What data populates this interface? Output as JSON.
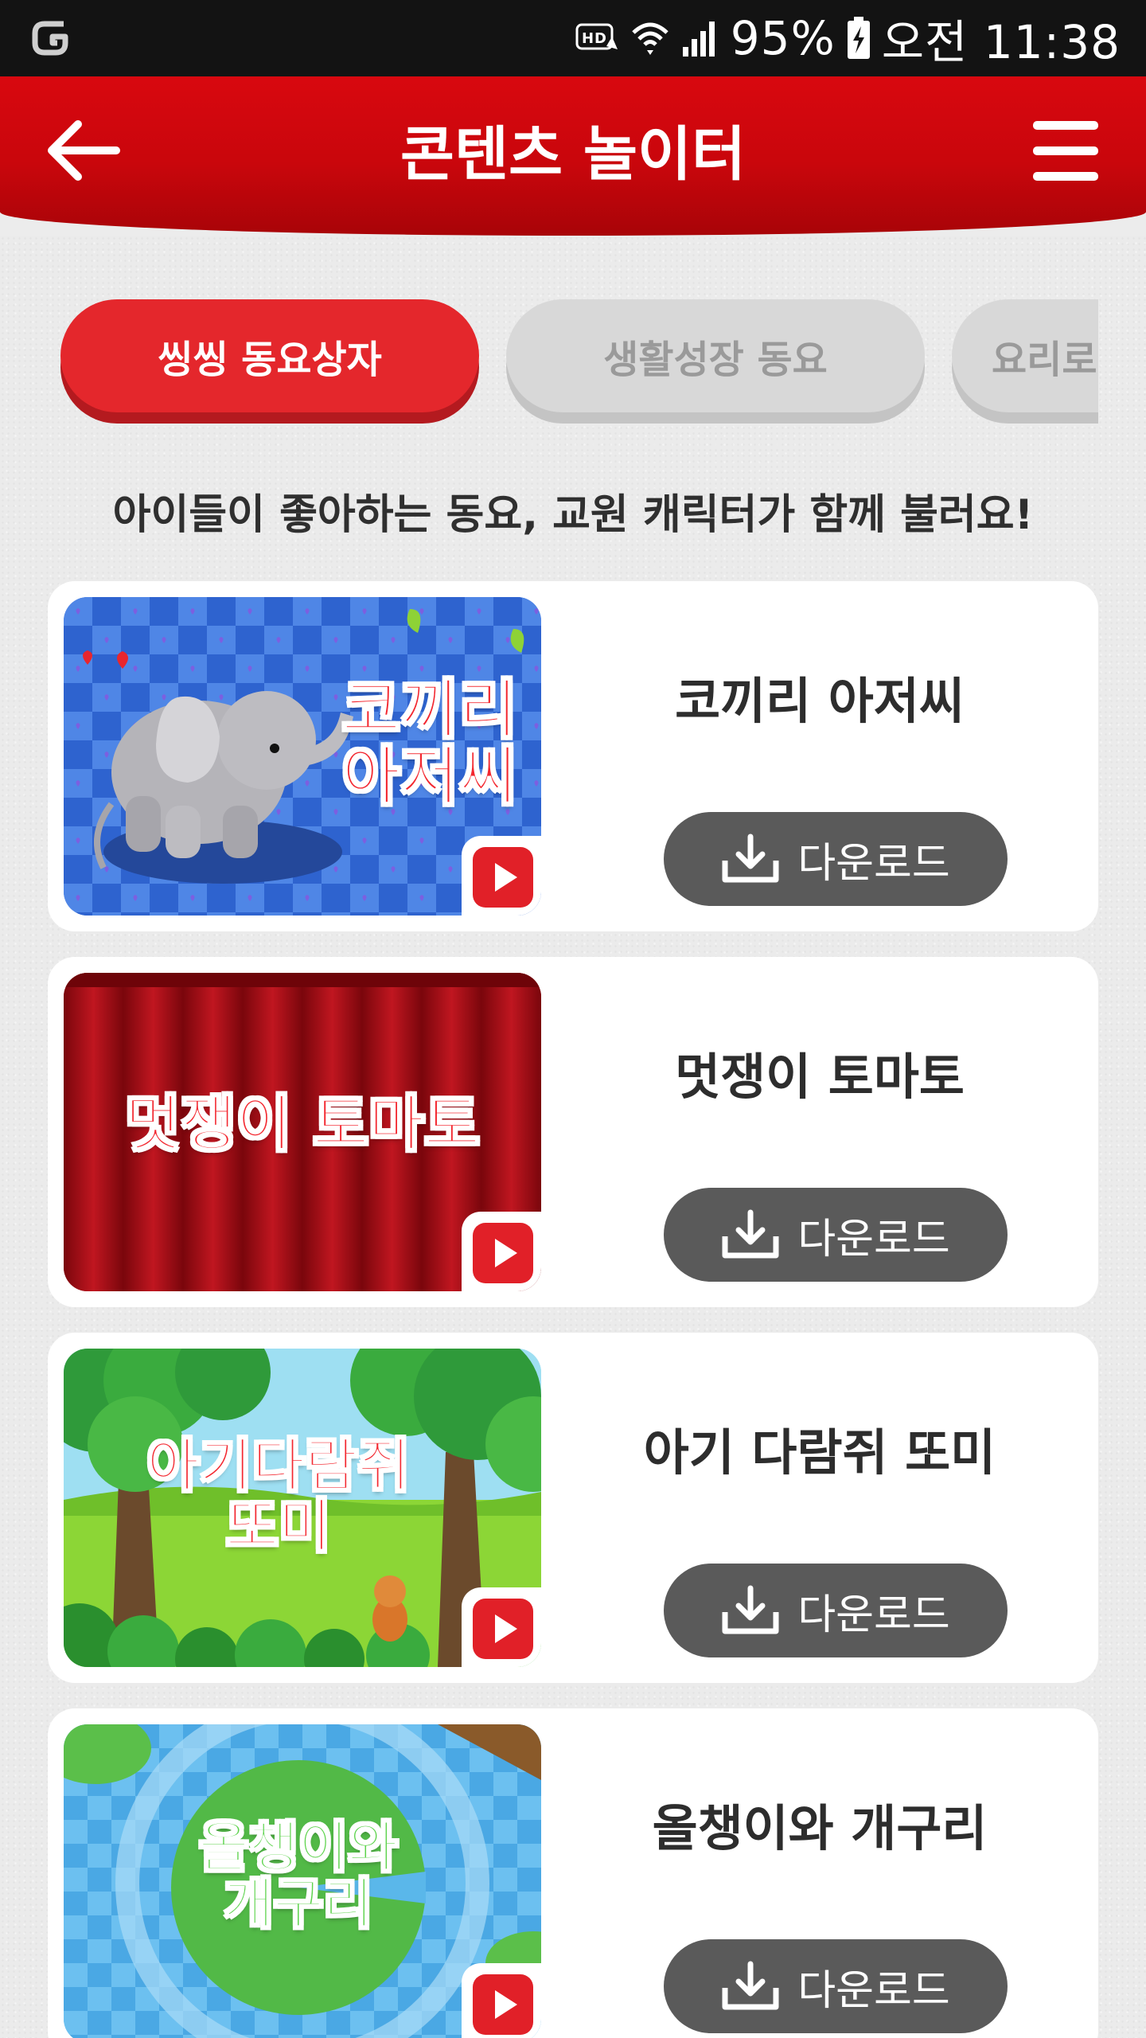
{
  "status_bar": {
    "hd": "HD",
    "battery": "95%",
    "time": "오전 11:38"
  },
  "header": {
    "title": "콘텐츠 놀이터"
  },
  "tabs": [
    {
      "label": "씽씽 동요상자",
      "active": true
    },
    {
      "label": "생활성장 동요",
      "active": false
    },
    {
      "label": "요리로",
      "active": false
    }
  ],
  "tagline": "아이들이 좋아하는 동요, 교원 캐릭터가 함께 불러요!",
  "songs": [
    {
      "title": "코끼리 아저씨",
      "thumb_text_1": "코끼리",
      "thumb_text_2": "아저씨",
      "download_label": "다운로드"
    },
    {
      "title": "멋쟁이 토마토",
      "thumb_text_1": "멋쟁이 토마토",
      "thumb_text_2": "",
      "download_label": "다운로드"
    },
    {
      "title": "아기 다람쥐 또미",
      "thumb_text_1": "아기다람쥐",
      "thumb_text_2": "또미",
      "download_label": "다운로드"
    },
    {
      "title": "올챙이와 개구리",
      "thumb_text_1": "올챙이와",
      "thumb_text_2": "개구리",
      "download_label": "다운로드"
    }
  ],
  "colors": {
    "header_red": "#d8080f",
    "active_tab": "#e4272c",
    "download_button": "#5a5a5a",
    "play_red": "#e12028"
  }
}
